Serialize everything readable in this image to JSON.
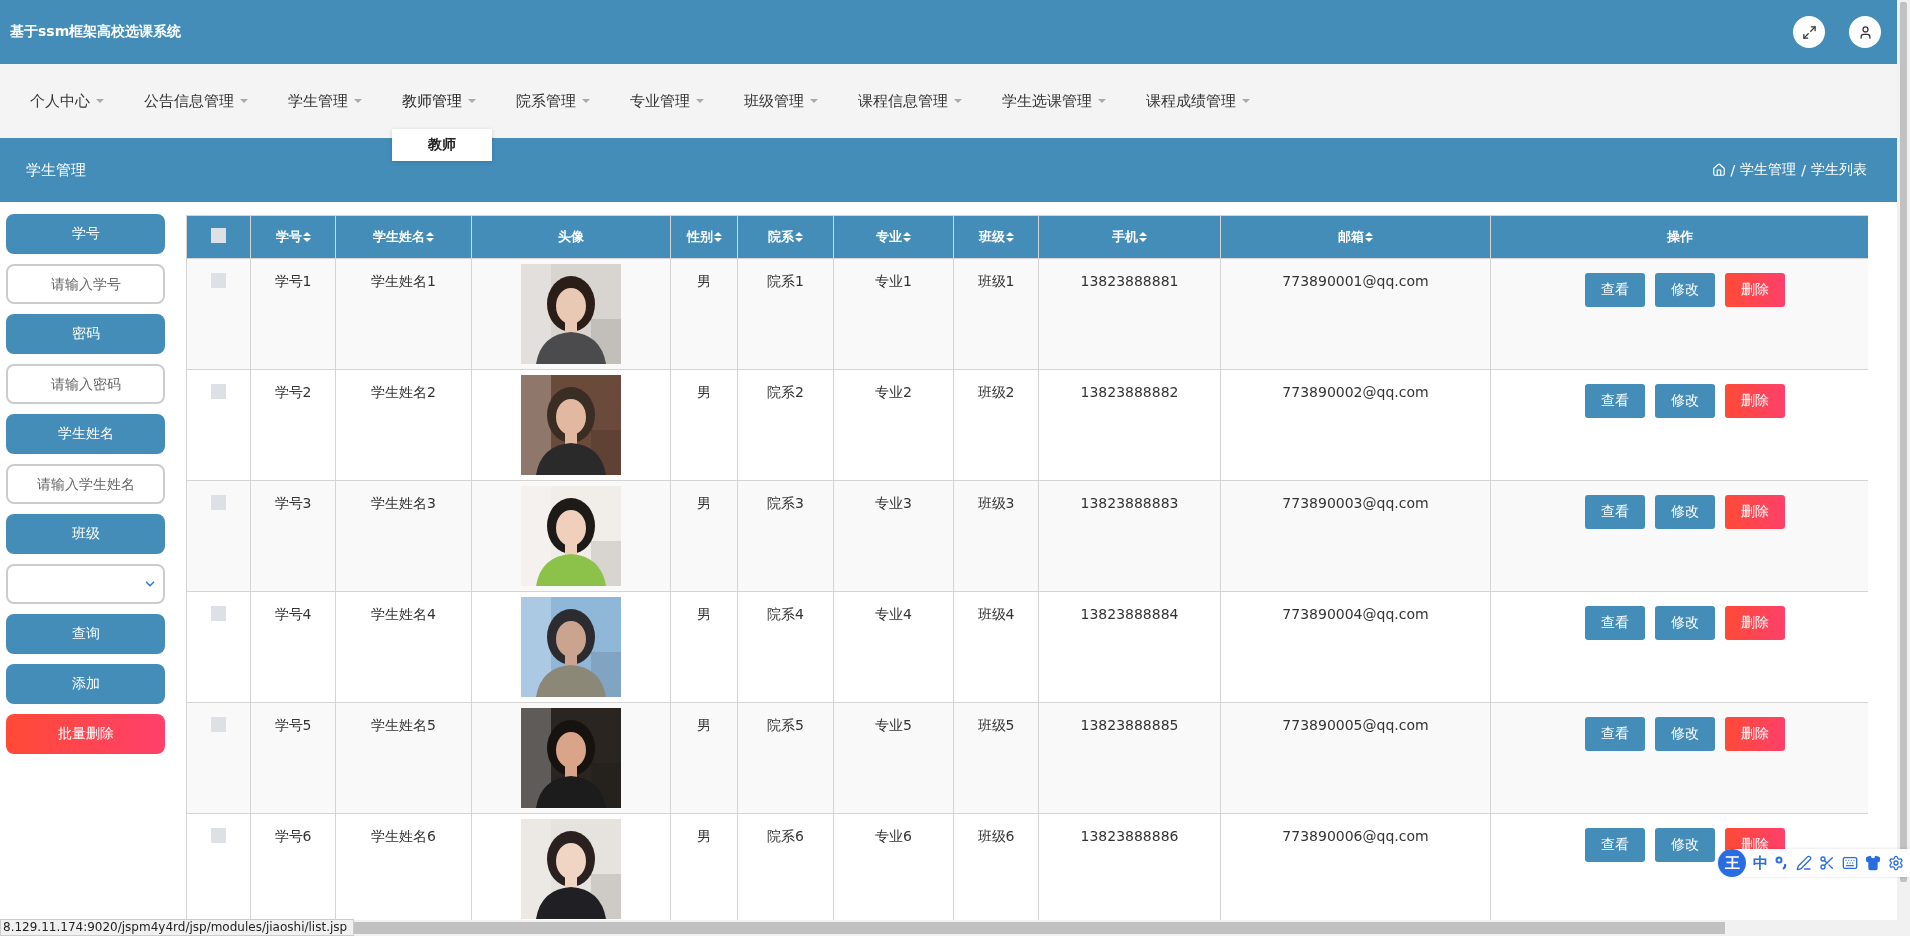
{
  "app_title": "基于ssm框架高校选课系统",
  "nav": [
    {
      "label": "个人中心",
      "expanded": false
    },
    {
      "label": "公告信息管理",
      "expanded": false
    },
    {
      "label": "学生管理",
      "expanded": false
    },
    {
      "label": "教师管理",
      "expanded": true,
      "menu": [
        "教师"
      ]
    },
    {
      "label": "院系管理",
      "expanded": false
    },
    {
      "label": "专业管理",
      "expanded": false
    },
    {
      "label": "班级管理",
      "expanded": false
    },
    {
      "label": "课程信息管理",
      "expanded": false
    },
    {
      "label": "学生选课管理",
      "expanded": false
    },
    {
      "label": "课程成绩管理",
      "expanded": false
    }
  ],
  "breadcrumb": {
    "title": "学生管理",
    "separator": "/",
    "items": [
      "学生管理",
      "学生列表"
    ]
  },
  "search": [
    {
      "kind": "label",
      "text": "学号"
    },
    {
      "kind": "input",
      "placeholder": "请输入学号"
    },
    {
      "kind": "label",
      "text": "密码"
    },
    {
      "kind": "input",
      "placeholder": "请输入密码"
    },
    {
      "kind": "label",
      "text": "学生姓名"
    },
    {
      "kind": "input",
      "placeholder": "请输入学生姓名"
    },
    {
      "kind": "label",
      "text": "班级"
    },
    {
      "kind": "select"
    },
    {
      "kind": "button",
      "text": "查询"
    },
    {
      "kind": "button",
      "text": "添加"
    },
    {
      "kind": "danger",
      "text": "批量删除"
    }
  ],
  "table": {
    "select_all_checked": false,
    "columns": [
      {
        "label": "学号",
        "sortable": true
      },
      {
        "label": "学生姓名",
        "sortable": true
      },
      {
        "label": "头像",
        "sortable": false
      },
      {
        "label": "性别",
        "sortable": true
      },
      {
        "label": "院系",
        "sortable": true
      },
      {
        "label": "专业",
        "sortable": true
      },
      {
        "label": "班级",
        "sortable": true
      },
      {
        "label": "手机",
        "sortable": true
      },
      {
        "label": "邮箱",
        "sortable": true
      },
      {
        "label": "操作",
        "sortable": false
      }
    ],
    "rows": [
      {
        "checked": false,
        "cells": [
          "学号1",
          "学生姓名1",
          null,
          "男",
          "院系1",
          "专业1",
          "班级1",
          "13823888881",
          "773890001@qq.com"
        ],
        "actions": [
          {
            "kind": "view",
            "label": "查看"
          },
          {
            "kind": "edit",
            "label": "修改"
          },
          {
            "kind": "delete",
            "label": "删除"
          }
        ]
      },
      {
        "checked": false,
        "cells": [
          "学号2",
          "学生姓名2",
          null,
          "男",
          "院系2",
          "专业2",
          "班级2",
          "13823888882",
          "773890002@qq.com"
        ],
        "actions": [
          {
            "kind": "view",
            "label": "查看"
          },
          {
            "kind": "edit",
            "label": "修改"
          },
          {
            "kind": "delete",
            "label": "删除"
          }
        ]
      },
      {
        "checked": false,
        "cells": [
          "学号3",
          "学生姓名3",
          null,
          "男",
          "院系3",
          "专业3",
          "班级3",
          "13823888883",
          "773890003@qq.com"
        ],
        "actions": [
          {
            "kind": "view",
            "label": "查看"
          },
          {
            "kind": "edit",
            "label": "修改"
          },
          {
            "kind": "delete",
            "label": "删除"
          }
        ]
      },
      {
        "checked": false,
        "cells": [
          "学号4",
          "学生姓名4",
          null,
          "男",
          "院系4",
          "专业4",
          "班级4",
          "13823888884",
          "773890004@qq.com"
        ],
        "actions": [
          {
            "kind": "view",
            "label": "查看"
          },
          {
            "kind": "edit",
            "label": "修改"
          },
          {
            "kind": "delete",
            "label": "删除"
          }
        ]
      },
      {
        "checked": false,
        "cells": [
          "学号5",
          "学生姓名5",
          null,
          "男",
          "院系5",
          "专业5",
          "班级5",
          "13823888885",
          "773890005@qq.com"
        ],
        "actions": [
          {
            "kind": "view",
            "label": "查看"
          },
          {
            "kind": "edit",
            "label": "修改"
          },
          {
            "kind": "delete",
            "label": "删除"
          }
        ]
      },
      {
        "checked": false,
        "cells": [
          "学号6",
          "学生姓名6",
          null,
          "男",
          "院系6",
          "专业6",
          "班级6",
          "13823888886",
          "773890006@qq.com"
        ],
        "actions": [
          {
            "kind": "view",
            "label": "查看"
          },
          {
            "kind": "edit",
            "label": "修改"
          },
          {
            "kind": "delete",
            "label": "删除"
          }
        ]
      }
    ]
  },
  "status_url": "8.129.11.174:9020/jspm4y4rd/jsp/modules/jiaoshi/list.jsp",
  "ime": {
    "logo": "王",
    "mode": "中"
  }
}
